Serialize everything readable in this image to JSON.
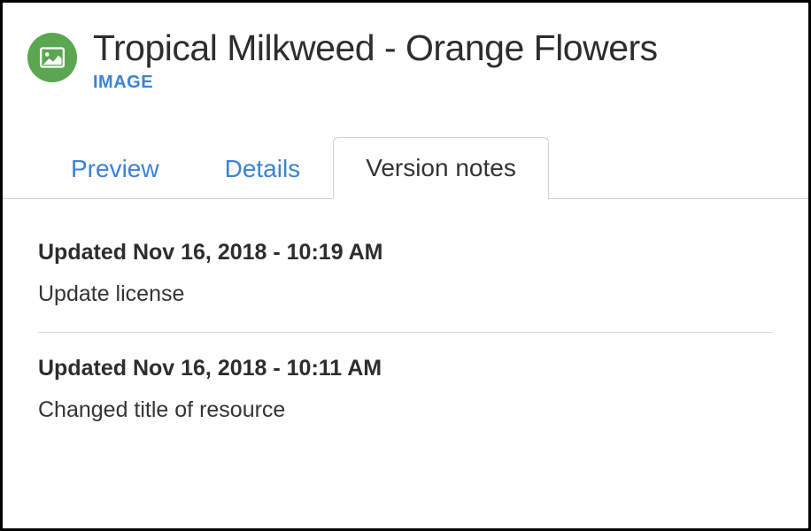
{
  "header": {
    "title": "Tropical Milkweed - Orange Flowers",
    "type_label": "IMAGE"
  },
  "tabs": {
    "items": [
      {
        "label": "Preview",
        "active": false
      },
      {
        "label": "Details",
        "active": false
      },
      {
        "label": "Version notes",
        "active": true
      }
    ]
  },
  "notes": [
    {
      "timestamp": "Updated Nov 16, 2018 - 10:19 AM",
      "body": "Update license"
    },
    {
      "timestamp": "Updated Nov 16, 2018 - 10:11 AM",
      "body": "Changed title of resource"
    }
  ]
}
